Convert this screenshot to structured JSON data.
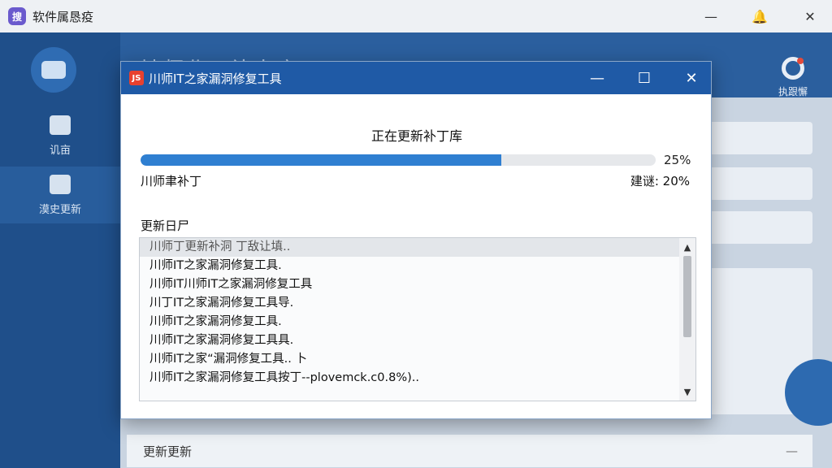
{
  "app": {
    "title": "软件属恳疫",
    "logo": "搜",
    "sidebar": [
      {
        "label": "讥亩",
        "icon": "gift-icon"
      },
      {
        "label": "漠史更新",
        "icon": "document-icon"
      }
    ],
    "header_text": "址师北IT补韦库",
    "settings_label": "执跟懈",
    "bottom_row_label": "更新更新",
    "bottom_row_minus": "—",
    "window_controls": {
      "minimize": "—",
      "bell": "🔔",
      "close": "✕"
    }
  },
  "dialog": {
    "title": "川师IT之家漏洞修复工具",
    "icon_text": "JS",
    "controls": {
      "minimize": "—",
      "maximize": "☐",
      "close": "✕"
    },
    "status_title": "正在更新补丁库",
    "progress": {
      "value": 0.25,
      "percent_label": "25%"
    },
    "sub_left": "川师聿补丁",
    "sub_right": "建谜: 20%",
    "log_label": "更新日尸",
    "log_lines": [
      "川师丁更新补洞 丁敌让填..",
      "川师IT之家漏洞修复工具.",
      "川师IT川师IT之家漏洞修复工具",
      "川丁IT之家漏洞修复工具导.",
      "川师IT之家漏洞修复工具.",
      "川师IT之家漏洞修复工具具.",
      "川师IT之家“漏洞修复工具.. 卜",
      "川师IT之家漏洞修复工具按丁--plovemck.c0.8%).."
    ]
  },
  "colors": {
    "accent": "#1f5aa6",
    "progress": "#2f7fd1",
    "sidebar": "#1f4f8a"
  }
}
